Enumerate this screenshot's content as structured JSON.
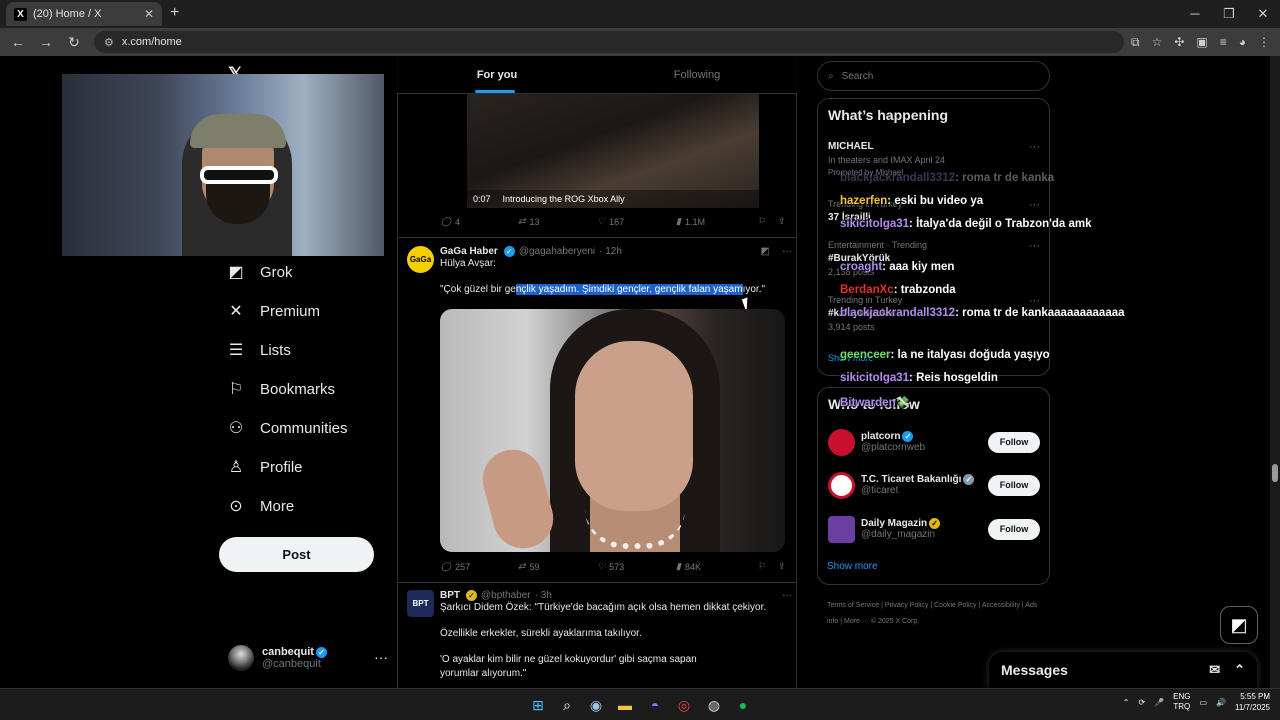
{
  "browser": {
    "tab_title": "(20) Home / X",
    "tab_favicon": "X",
    "url": "x.com/home"
  },
  "sidebar": {
    "nav": [
      {
        "icon": "grok-icon",
        "label": "Grok"
      },
      {
        "icon": "x-icon",
        "label": "Premium"
      },
      {
        "icon": "lists-icon",
        "label": "Lists"
      },
      {
        "icon": "bookmark-icon",
        "label": "Bookmarks"
      },
      {
        "icon": "communities-icon",
        "label": "Communities"
      },
      {
        "icon": "profile-icon",
        "label": "Profile"
      },
      {
        "icon": "more-icon",
        "label": "More"
      }
    ],
    "post_label": "Post",
    "account_name": "canbequit",
    "account_handle": "@canbequit"
  },
  "feed": {
    "tabs": [
      "For you",
      "Following"
    ],
    "video": {
      "duration": "0:07",
      "caption": "Introducing the ROG Xbox Ally"
    },
    "tweet1_actions": {
      "replies": "4",
      "retweets": "13",
      "likes": "167",
      "views": "1.1M"
    },
    "tweet2": {
      "name": "GaGa Haber",
      "handle": "@gagahaberyeni",
      "time": "· 12h",
      "avatar_text": "GaGa",
      "line1": "Hülya Avşar:",
      "quote_a": "\"Çok güzel bir ge",
      "quote_hl": "nçlik yaşadım. Şimdiki gençler, gençlik falan yaşam",
      "quote_b": "ıyor.\"",
      "actions": {
        "replies": "257",
        "retweets": "59",
        "likes": "573",
        "views": "84K"
      }
    },
    "tweet3": {
      "name": "BPT",
      "handle": "@bpthaber",
      "time": "· 3h",
      "avatar_text": "BPT",
      "line1": "Şarkıcı Didem Özek: \"Türkiye'de bacağım açık olsa hemen dikkat çekiyor.",
      "line2": "Özellikle erkekler, sürekli ayaklarıma takılıyor.",
      "line3": "'O ayaklar kim bilir ne güzel kokuyordur' gibi saçma sapan",
      "line4": "yorumlar alıyorum.\""
    }
  },
  "right": {
    "search_placeholder": "Search",
    "happening_title": "What’s happening",
    "trends": [
      {
        "title": "MICHAEL",
        "sub": "In theaters and IMAX April 24",
        "meta": "Promoted by Michael"
      },
      {
        "title": "37 İsrailli",
        "sub": "Trending in Turkey",
        "meta": ""
      },
      {
        "title": "#BurakYörük",
        "sub": "Entertainment · Trending",
        "meta": "2,138 posts"
      },
      {
        "title": "#kaleyebaskın",
        "sub": "Trending in Turkey",
        "meta": "3,914 posts"
      }
    ],
    "show_more": "Show more",
    "follow_title": "Who to follow",
    "follow": [
      {
        "name": "platcorn",
        "handle": "@platcornweb",
        "badge": "blue",
        "btn": "Follow",
        "color": "#c8102e"
      },
      {
        "name": "T.C. Ticaret Bakanlığı",
        "handle": "@ticaret",
        "badge": "gray",
        "btn": "Follow",
        "color": "#ffffff"
      },
      {
        "name": "Daily Magazin",
        "handle": "@daily_magazin",
        "badge": "gold",
        "btn": "Follow",
        "color": "#6a3fa0"
      }
    ],
    "footer": "Terms of Service  |  Privacy Policy  |  Cookie Policy  |  Accessibility  |  Ads info  |  More ···  © 2025 X Corp.",
    "messages": "Messages"
  },
  "chat": [
    {
      "user": "blackjackrandall3312",
      "color": "#b48cf0",
      "msg": ": roma tr de kanka"
    },
    {
      "user": "hazerfen",
      "color": "#f5c242",
      "msg": ": eski bu video ya"
    },
    {
      "user": "sikicitolga31",
      "color": "#b48cf0",
      "msg": ": İtalya'da değil o Trabzon'da amk"
    },
    {
      "user": "croaght",
      "color": "#b48cf0",
      "msg": ": aaa kiy men"
    },
    {
      "user": "BerdanXc",
      "color": "#e0302a",
      "msg": ": trabzonda"
    },
    {
      "user": "blackjackrandall3312",
      "color": "#b48cf0",
      "msg": ": roma tr de kankaaaaaaaaaaaa"
    },
    {
      "user": "geenceer",
      "color": "#6ee06e",
      "msg": ": la ne italyası doğuda yaşıyo"
    },
    {
      "user": "sikicitolga31",
      "color": "#b48cf0",
      "msg": ": Reis hosgeldin"
    },
    {
      "user": "Bitwarden",
      "color": "#b48cf0",
      "msg": "💸"
    }
  ],
  "taskbar": {
    "lang1": "ENG",
    "lang2": "TRQ",
    "time": "5:55 PM",
    "date": "11/7/2025"
  }
}
